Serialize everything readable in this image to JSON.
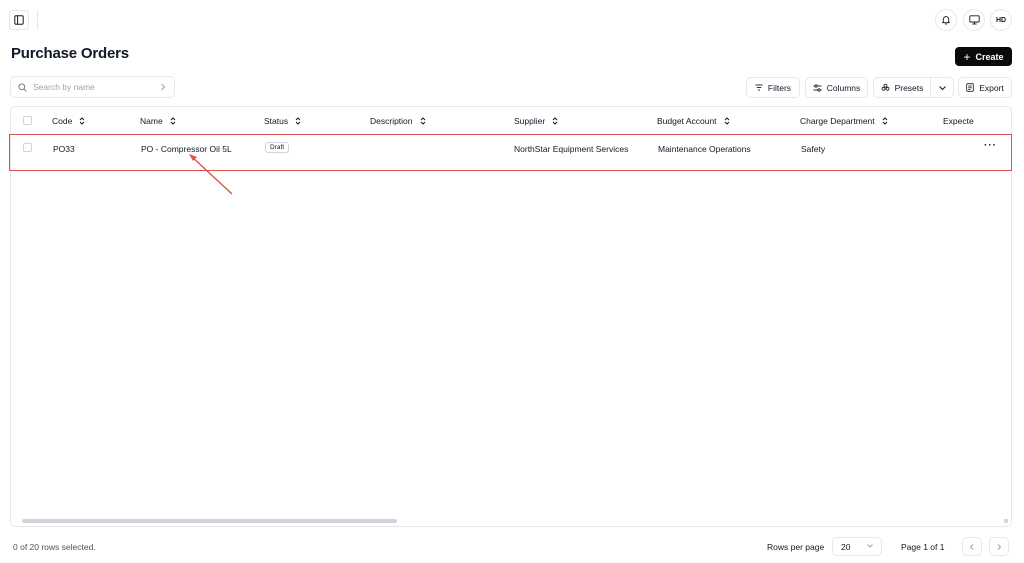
{
  "header": {
    "avatar_initials": "HD"
  },
  "page": {
    "title": "Purchase Orders",
    "create_label": "Create"
  },
  "toolbar": {
    "search_placeholder": "Search by name",
    "filters_label": "Filters",
    "columns_label": "Columns",
    "presets_label": "Presets",
    "export_label": "Export"
  },
  "table": {
    "columns": [
      "Code",
      "Name",
      "Status",
      "Description",
      "Supplier",
      "Budget Account",
      "Charge Department",
      "Expecte"
    ],
    "rows": [
      {
        "code": "PO33",
        "name": "PO - Compressor Oil 5L",
        "status": "Draft",
        "description": "",
        "supplier": "NorthStar Equipment Services",
        "budget_account": "Maintenance Operations",
        "charge_department": "Safety",
        "expected": ""
      }
    ]
  },
  "footer": {
    "selection_text": "0 of 20 rows selected.",
    "rows_per_page_label": "Rows per page",
    "rows_per_page_value": "20",
    "page_text": "Page 1 of 1"
  },
  "colors": {
    "primary": "#0a0a0a",
    "highlight": "#d9534f",
    "border": "#e5e7eb"
  }
}
